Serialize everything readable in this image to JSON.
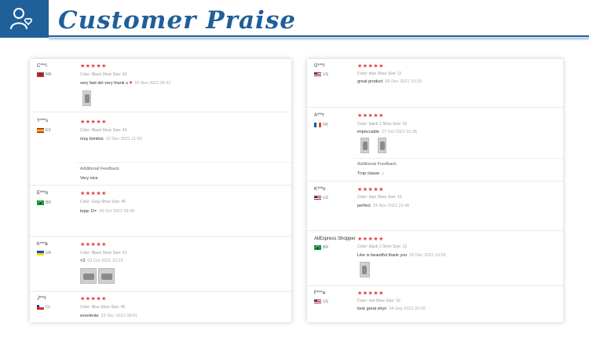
{
  "header": {
    "title": "Customer Praise",
    "icon": "user-heart-icon",
    "accent": "#1f5f9a"
  },
  "star_color": "#e6393e",
  "rating_glyph": "★★★★★",
  "left_reviews": [
    {
      "name": "C***i",
      "country": "MA",
      "meta": "Color: Black   Shoe Size: 43",
      "comment": "very fast del very thank u",
      "date": "15 Nov 2021 06:57"
    },
    {
      "name": "Y***s",
      "country": "ES",
      "meta": "Color: Black   Shoe Size: 45",
      "comment": "muy bonitos",
      "date": "22 Dec 2021 11:50",
      "additional_label": "Additional Feedback",
      "additional_text": "Very nice"
    },
    {
      "name": "E***o",
      "country": "BR",
      "meta": "Color: Gray   Shoe Size: 46",
      "comment": "topp. D=",
      "date": "28 Oct 2021 09:26"
    },
    {
      "name": "К***в",
      "country": "UA",
      "meta": "Color: Black   Shoe Size: 41",
      "comment": "<3",
      "date": "03 Oct 2021 10:15"
    },
    {
      "name": "J***r",
      "country": "CL",
      "meta": "Color: Blue   Shoe Size: 45",
      "comment": "excelente",
      "date": "22 Dec 2021 08:01"
    }
  ],
  "right_reviews": [
    {
      "name": "G***l",
      "country": "US",
      "meta": "Color: blue   Shoe Size: 11",
      "comment": "great product",
      "date": "06 Dec 2021 10:20"
    },
    {
      "name": "A***r",
      "country": "FR",
      "meta": "Color: black 1   Shoe Size: 10",
      "comment": "impeccable",
      "date": "27 Oct 2021 01:36",
      "additional_label": "Additional Feedback",
      "additional_text": "Trop classe",
      "additional_suffix": "☺"
    },
    {
      "name": "K***o",
      "country": "US",
      "meta": "Color: blue   Shoe Size: 10",
      "comment": "perfect",
      "date": "24 Nov 2021 22:46"
    },
    {
      "name": "AliExpress Shopper",
      "country": "BR",
      "meta": "Color: black 1   Shoe Size: 12",
      "comment": "Like is beautiful thank you",
      "date": "06 Dec 2021 15:55"
    },
    {
      "name": "F***a",
      "country": "US",
      "meta": "Color: red   Shoe Size: 10",
      "comment": "look great shyn",
      "date": "24 Sep 2021 20:26"
    }
  ]
}
